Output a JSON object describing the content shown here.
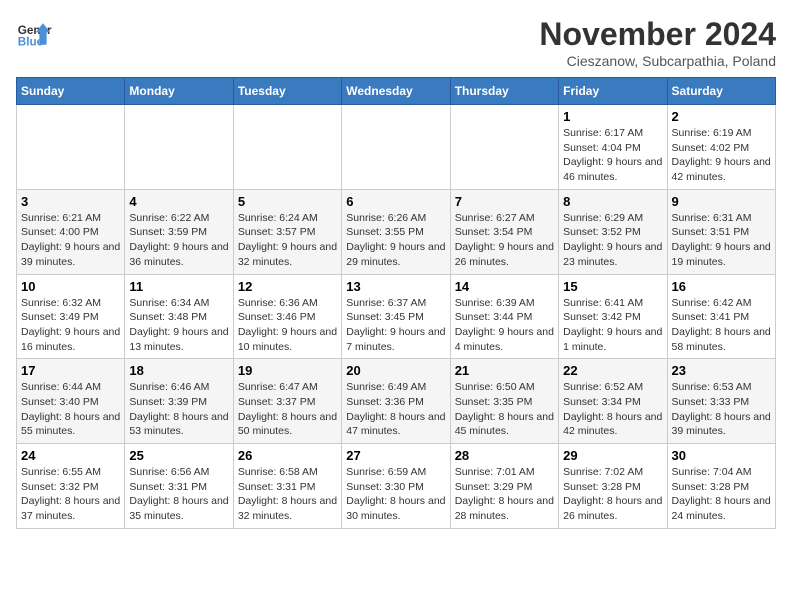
{
  "logo": {
    "text_general": "General",
    "text_blue": "Blue"
  },
  "title": "November 2024",
  "location": "Cieszanow, Subcarpathia, Poland",
  "weekdays": [
    "Sunday",
    "Monday",
    "Tuesday",
    "Wednesday",
    "Thursday",
    "Friday",
    "Saturday"
  ],
  "weeks": [
    [
      {
        "day": "",
        "info": ""
      },
      {
        "day": "",
        "info": ""
      },
      {
        "day": "",
        "info": ""
      },
      {
        "day": "",
        "info": ""
      },
      {
        "day": "",
        "info": ""
      },
      {
        "day": "1",
        "info": "Sunrise: 6:17 AM\nSunset: 4:04 PM\nDaylight: 9 hours and 46 minutes."
      },
      {
        "day": "2",
        "info": "Sunrise: 6:19 AM\nSunset: 4:02 PM\nDaylight: 9 hours and 42 minutes."
      }
    ],
    [
      {
        "day": "3",
        "info": "Sunrise: 6:21 AM\nSunset: 4:00 PM\nDaylight: 9 hours and 39 minutes."
      },
      {
        "day": "4",
        "info": "Sunrise: 6:22 AM\nSunset: 3:59 PM\nDaylight: 9 hours and 36 minutes."
      },
      {
        "day": "5",
        "info": "Sunrise: 6:24 AM\nSunset: 3:57 PM\nDaylight: 9 hours and 32 minutes."
      },
      {
        "day": "6",
        "info": "Sunrise: 6:26 AM\nSunset: 3:55 PM\nDaylight: 9 hours and 29 minutes."
      },
      {
        "day": "7",
        "info": "Sunrise: 6:27 AM\nSunset: 3:54 PM\nDaylight: 9 hours and 26 minutes."
      },
      {
        "day": "8",
        "info": "Sunrise: 6:29 AM\nSunset: 3:52 PM\nDaylight: 9 hours and 23 minutes."
      },
      {
        "day": "9",
        "info": "Sunrise: 6:31 AM\nSunset: 3:51 PM\nDaylight: 9 hours and 19 minutes."
      }
    ],
    [
      {
        "day": "10",
        "info": "Sunrise: 6:32 AM\nSunset: 3:49 PM\nDaylight: 9 hours and 16 minutes."
      },
      {
        "day": "11",
        "info": "Sunrise: 6:34 AM\nSunset: 3:48 PM\nDaylight: 9 hours and 13 minutes."
      },
      {
        "day": "12",
        "info": "Sunrise: 6:36 AM\nSunset: 3:46 PM\nDaylight: 9 hours and 10 minutes."
      },
      {
        "day": "13",
        "info": "Sunrise: 6:37 AM\nSunset: 3:45 PM\nDaylight: 9 hours and 7 minutes."
      },
      {
        "day": "14",
        "info": "Sunrise: 6:39 AM\nSunset: 3:44 PM\nDaylight: 9 hours and 4 minutes."
      },
      {
        "day": "15",
        "info": "Sunrise: 6:41 AM\nSunset: 3:42 PM\nDaylight: 9 hours and 1 minute."
      },
      {
        "day": "16",
        "info": "Sunrise: 6:42 AM\nSunset: 3:41 PM\nDaylight: 8 hours and 58 minutes."
      }
    ],
    [
      {
        "day": "17",
        "info": "Sunrise: 6:44 AM\nSunset: 3:40 PM\nDaylight: 8 hours and 55 minutes."
      },
      {
        "day": "18",
        "info": "Sunrise: 6:46 AM\nSunset: 3:39 PM\nDaylight: 8 hours and 53 minutes."
      },
      {
        "day": "19",
        "info": "Sunrise: 6:47 AM\nSunset: 3:37 PM\nDaylight: 8 hours and 50 minutes."
      },
      {
        "day": "20",
        "info": "Sunrise: 6:49 AM\nSunset: 3:36 PM\nDaylight: 8 hours and 47 minutes."
      },
      {
        "day": "21",
        "info": "Sunrise: 6:50 AM\nSunset: 3:35 PM\nDaylight: 8 hours and 45 minutes."
      },
      {
        "day": "22",
        "info": "Sunrise: 6:52 AM\nSunset: 3:34 PM\nDaylight: 8 hours and 42 minutes."
      },
      {
        "day": "23",
        "info": "Sunrise: 6:53 AM\nSunset: 3:33 PM\nDaylight: 8 hours and 39 minutes."
      }
    ],
    [
      {
        "day": "24",
        "info": "Sunrise: 6:55 AM\nSunset: 3:32 PM\nDaylight: 8 hours and 37 minutes."
      },
      {
        "day": "25",
        "info": "Sunrise: 6:56 AM\nSunset: 3:31 PM\nDaylight: 8 hours and 35 minutes."
      },
      {
        "day": "26",
        "info": "Sunrise: 6:58 AM\nSunset: 3:31 PM\nDaylight: 8 hours and 32 minutes."
      },
      {
        "day": "27",
        "info": "Sunrise: 6:59 AM\nSunset: 3:30 PM\nDaylight: 8 hours and 30 minutes."
      },
      {
        "day": "28",
        "info": "Sunrise: 7:01 AM\nSunset: 3:29 PM\nDaylight: 8 hours and 28 minutes."
      },
      {
        "day": "29",
        "info": "Sunrise: 7:02 AM\nSunset: 3:28 PM\nDaylight: 8 hours and 26 minutes."
      },
      {
        "day": "30",
        "info": "Sunrise: 7:04 AM\nSunset: 3:28 PM\nDaylight: 8 hours and 24 minutes."
      }
    ]
  ]
}
